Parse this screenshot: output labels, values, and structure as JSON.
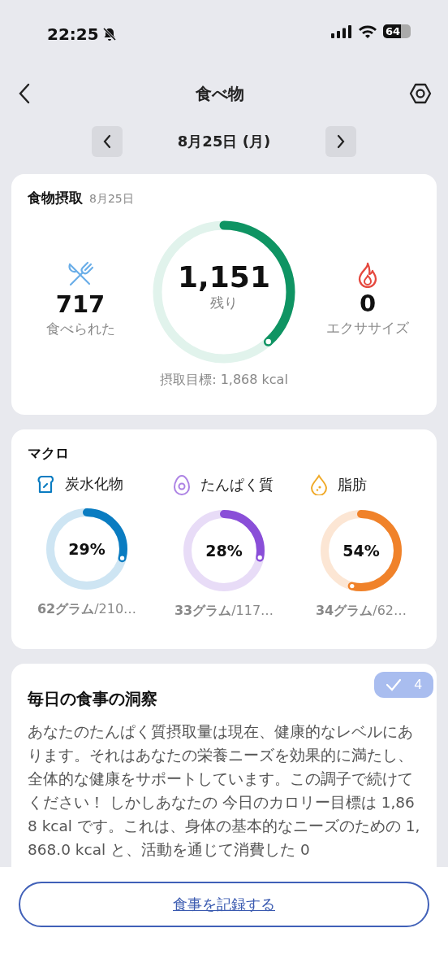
{
  "status_bar": {
    "time": "22:25",
    "battery": "64"
  },
  "header": {
    "title": "食べ物"
  },
  "date_nav": {
    "date": "8月25日 (月)"
  },
  "intake": {
    "title": "食物摂取",
    "date": "8月25日",
    "eaten_value": "717",
    "eaten_label": "食べられた",
    "remaining_value": "1,151",
    "remaining_label": "残り",
    "exercise_value": "0",
    "exercise_label": "エクササイズ",
    "goal": "摂取目標: 1,868 kcal"
  },
  "macros": {
    "title": "マクロ",
    "items": [
      {
        "name": "炭水化物",
        "color": "#0a7cc1",
        "percent": "29%",
        "grams": "**62グラム**/210…"
      },
      {
        "name": "たんぱく質",
        "color": "#8a4fd8",
        "percent": "28%",
        "grams": "**33グラム**/117…"
      },
      {
        "name": "脂肪",
        "color": "#f0822a",
        "percent": "54%",
        "grams": "**34グラム**/62…"
      }
    ]
  },
  "insight": {
    "title": "毎日の食事の洞察",
    "count": "4",
    "text": "あなたのたんぱく質摂取量は現在、健康的なレベルにあります。それはあなたの栄養ニーズを効果的に満たし、全体的な健康をサポートしています。この調子で続けてください！ しかしあなたの 今日のカロリー目標は 1,868 kcal です。これは、身体の基本的なニーズのための 1,868.0 kcal と、活動を通じて消費した 0"
  },
  "bottom_button": {
    "label": "食事を記録する"
  }
}
